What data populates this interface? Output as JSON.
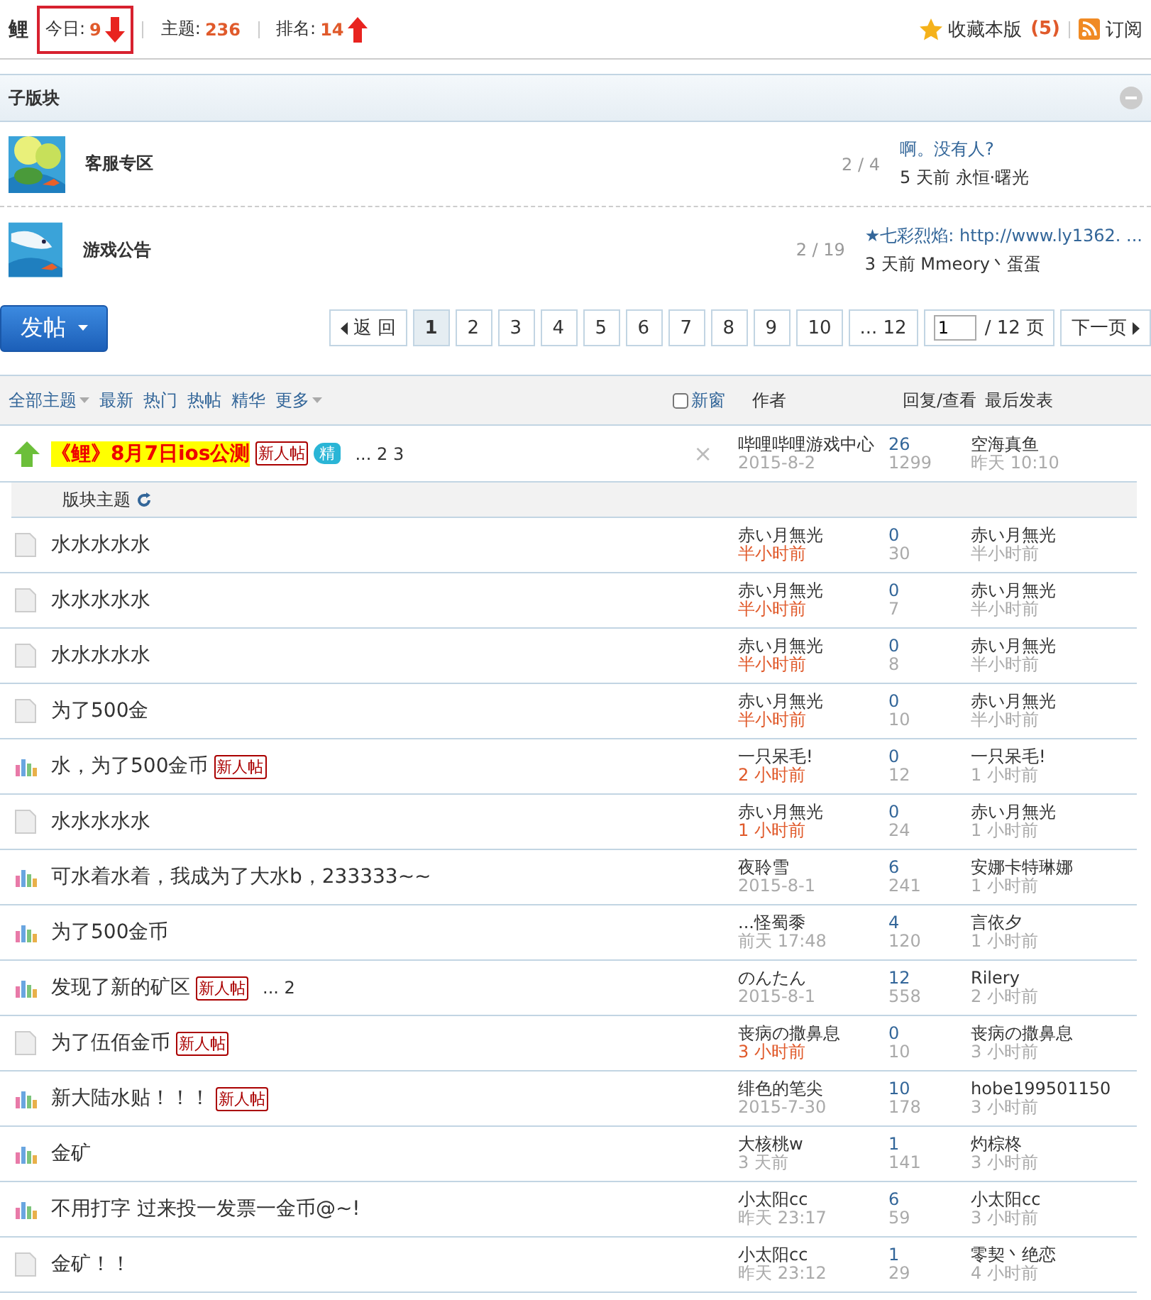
{
  "header": {
    "forum_name": "鲤",
    "stats": [
      {
        "label": "今日:",
        "value": "9",
        "kind": "falling",
        "highlighted": true
      },
      {
        "label": "主题:",
        "value": "236",
        "kind": "plain",
        "highlighted": false
      },
      {
        "label": "排名:",
        "value": "14",
        "kind": "rising",
        "highlighted": false
      }
    ],
    "favorite": {
      "label": "收藏本版",
      "count": "(5)"
    },
    "subscribe": "订阅"
  },
  "subforums": {
    "title": "子版块",
    "items": [
      {
        "name": "客服专区",
        "counts": "2 / 4",
        "last_title": "啊。没有人?",
        "last_info": "5 天前 永恒·曙光"
      },
      {
        "name": "游戏公告",
        "counts": "2 / 19",
        "last_title": "★七彩烈焰: http://www.ly1362. ...",
        "last_info": "3 天前 Mmeory丶蛋蛋"
      }
    ]
  },
  "post_button": "发帖",
  "pagination": {
    "back": "返 回",
    "pages": [
      {
        "label": "1",
        "selected": true
      },
      {
        "label": "2",
        "selected": false
      },
      {
        "label": "3",
        "selected": false
      },
      {
        "label": "4",
        "selected": false
      },
      {
        "label": "5",
        "selected": false
      },
      {
        "label": "6",
        "selected": false
      },
      {
        "label": "7",
        "selected": false
      },
      {
        "label": "8",
        "selected": false
      },
      {
        "label": "9",
        "selected": false
      },
      {
        "label": "10",
        "selected": false
      },
      {
        "label": "... 12",
        "selected": false
      }
    ],
    "page_input": "1",
    "total": "/ 12 页",
    "next": "下一页"
  },
  "filters": [
    {
      "label": "全部主题",
      "dropdown": true
    },
    {
      "label": "最新",
      "dropdown": false
    },
    {
      "label": "热门",
      "dropdown": false
    },
    {
      "label": "热帖",
      "dropdown": false
    },
    {
      "label": "精华",
      "dropdown": false
    },
    {
      "label": "更多",
      "dropdown": true
    }
  ],
  "new_window": {
    "label": "新窗",
    "checked": false
  },
  "columns": [
    "作者",
    "回复/查看",
    "最后发表"
  ],
  "sticky": {
    "title": "《鲤》8月7日ios公测",
    "badge": "新人帖",
    "digest": "精",
    "pages": "... 2 3",
    "close": "×",
    "author": "哔哩哔哩游戏中心",
    "author_time": "2015-8-2",
    "replies": "26",
    "views": "1299",
    "last_user": "空海真鱼",
    "last_time": "昨天 10:10"
  },
  "section_title": "版块主题",
  "threads": [
    {
      "kind": "plain",
      "title": "水水水水水",
      "author": "赤い月無光",
      "author_time": "半小时前",
      "fresh": true,
      "replies": "0",
      "views": "30",
      "last_user": "赤い月無光",
      "last_time": "半小时前"
    },
    {
      "kind": "plain",
      "title": "水水水水水",
      "author": "赤い月無光",
      "author_time": "半小时前",
      "fresh": true,
      "replies": "0",
      "views": "7",
      "last_user": "赤い月無光",
      "last_time": "半小时前"
    },
    {
      "kind": "plain",
      "title": "水水水水水",
      "author": "赤い月無光",
      "author_time": "半小时前",
      "fresh": true,
      "replies": "0",
      "views": "8",
      "last_user": "赤い月無光",
      "last_time": "半小时前"
    },
    {
      "kind": "plain",
      "title": "为了500金",
      "author": "赤い月無光",
      "author_time": "半小时前",
      "fresh": true,
      "replies": "0",
      "views": "10",
      "last_user": "赤い月無光",
      "last_time": "半小时前"
    },
    {
      "kind": "poll",
      "title": "水，为了500金币",
      "badge": "新人帖",
      "author": "一只呆毛!",
      "author_time": "2 小时前",
      "fresh": true,
      "replies": "0",
      "views": "12",
      "last_user": "一只呆毛!",
      "last_time": "1 小时前"
    },
    {
      "kind": "plain",
      "title": "水水水水水",
      "author": "赤い月無光",
      "author_time": "1 小时前",
      "fresh": true,
      "replies": "0",
      "views": "24",
      "last_user": "赤い月無光",
      "last_time": "1 小时前"
    },
    {
      "kind": "poll",
      "title": "可水着水着，我成为了大水b，233333~~",
      "author": "夜聆雪",
      "author_time": "2015-8-1",
      "fresh": false,
      "replies": "6",
      "views": "241",
      "last_user": "安娜卡特琳娜",
      "last_time": "1 小时前"
    },
    {
      "kind": "poll",
      "title": "为了500金币",
      "author": "...怪蜀黍",
      "author_time": "前天 17:48",
      "fresh": false,
      "replies": "4",
      "views": "120",
      "last_user": "言依夕",
      "last_time": "1 小时前"
    },
    {
      "kind": "poll",
      "title": "发现了新的矿区",
      "badge": "新人帖",
      "pages": "... 2",
      "author": "のんたん",
      "author_time": "2015-8-1",
      "fresh": false,
      "replies": "12",
      "views": "558",
      "last_user": "Rilery",
      "last_time": "2 小时前"
    },
    {
      "kind": "plain",
      "title": "为了伍佰金币",
      "badge": "新人帖",
      "author": "丧病の撒鼻息",
      "author_time": "3 小时前",
      "fresh": true,
      "replies": "0",
      "views": "10",
      "last_user": "丧病の撒鼻息",
      "last_time": "3 小时前"
    },
    {
      "kind": "poll",
      "title": "新大陆水贴！！！",
      "badge": "新人帖",
      "author": "绯色的笔尖",
      "author_time": "2015-7-30",
      "fresh": false,
      "replies": "10",
      "views": "178",
      "last_user": "hobe199501150",
      "last_time": "3 小时前"
    },
    {
      "kind": "poll",
      "title": "金矿",
      "author": "大核桃w",
      "author_time": "3 天前",
      "fresh": false,
      "replies": "1",
      "views": "141",
      "last_user": "灼棕柊",
      "last_time": "3 小时前"
    },
    {
      "kind": "poll",
      "title": "不用打字 过来投一发票一金币@~!",
      "author": "小太阳cc",
      "author_time": "昨天 23:17",
      "fresh": false,
      "replies": "6",
      "views": "59",
      "last_user": "小太阳cc",
      "last_time": "3 小时前"
    },
    {
      "kind": "plain",
      "title": "金矿！！",
      "author": "小太阳cc",
      "author_time": "昨天 23:12",
      "fresh": false,
      "replies": "1",
      "views": "29",
      "last_user": "零契丶绝恋",
      "last_time": "4 小时前"
    }
  ]
}
